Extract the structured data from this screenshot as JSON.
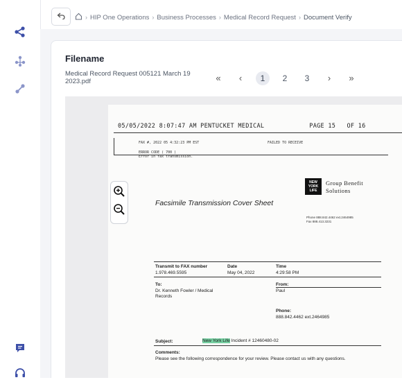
{
  "breadcrumb": {
    "items": [
      "HIP One Operations",
      "Business Processes",
      "Medical Record Request",
      "Document Verify"
    ]
  },
  "file": {
    "heading": "Filename",
    "name": "Medical Record Request 005121 March 19 2023.pdf"
  },
  "pager": {
    "first": "«",
    "prev": "‹",
    "pages": [
      "1",
      "2",
      "3"
    ],
    "current": "1",
    "next": "›",
    "last": "»"
  },
  "document": {
    "fax_header": "05/05/2022 8:07:47 AM PENTUCKET MEDICAL            PAGE 15   OF 16",
    "fax_line1": "FAX #, 2022 05 4:32:23 PM EST",
    "fax_line2": "ERROR CODE ( 700 )",
    "fax_line3": "Error in fax transmission.",
    "fax_line4": "FAILED TO RECEIVE",
    "cover_title": "Facsimile Transmission Cover Sheet",
    "logo_text": "NEW YORK LIFE",
    "company_line1": "Group Benefit",
    "company_line2": "Solutions",
    "company_phone": "Phone 888.842.4462 ext.2464985",
    "company_fax": "Fax 888.413.3231",
    "transmit_label": "Transmit to FAX number",
    "transmit_value": "1.978.469.5595",
    "date_label": "Date",
    "date_value": "May 04, 2022",
    "time_label": "Time",
    "time_value": "4:29:58 PM",
    "to_label": "To:",
    "to_value_1": "Dr. Kenneth Fowler / Medical",
    "to_value_2": "Records",
    "from_label": "From:",
    "from_value": "Paul",
    "phone_label": "Phone:",
    "phone_value": "888.842.4462 ext.2464985",
    "subject_label": "Subject:",
    "subject_highlight": "New York Life",
    "subject_rest": " Incident # 12460480-02",
    "comments_label": "Comments:",
    "comments_value": "Please see the following correspondence for your review. Please contact us with any questions."
  },
  "colors": {
    "rail_icon": "#3d4fa8",
    "highlight": "#76d0a2"
  },
  "icons": [
    "share-icon",
    "nodes-icon",
    "link-icon",
    "chat-icon",
    "headset-icon",
    "back-arrow-icon",
    "home-icon",
    "zoom-in-icon",
    "zoom-out-icon"
  ]
}
